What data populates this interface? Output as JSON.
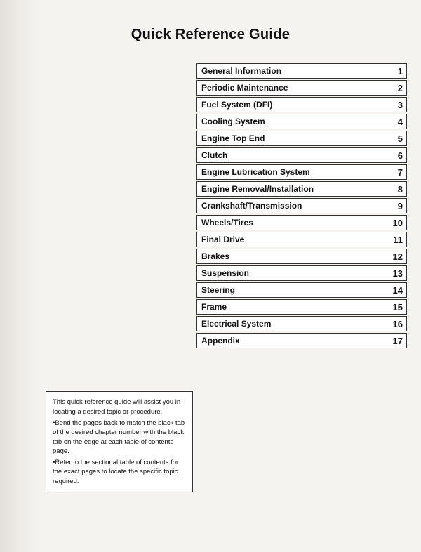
{
  "page": {
    "title": "Quick Reference Guide",
    "toc": [
      {
        "label": "General Information",
        "number": "1"
      },
      {
        "label": "Periodic Maintenance",
        "number": "2"
      },
      {
        "label": "Fuel System (DFI)",
        "number": "3"
      },
      {
        "label": "Cooling System",
        "number": "4"
      },
      {
        "label": "Engine Top End",
        "number": "5"
      },
      {
        "label": "Clutch",
        "number": "6"
      },
      {
        "label": "Engine Lubrication System",
        "number": "7"
      },
      {
        "label": "Engine Removal/Installation",
        "number": "8"
      },
      {
        "label": "Crankshaft/Transmission",
        "number": "9"
      },
      {
        "label": "Wheels/Tires",
        "number": "10"
      },
      {
        "label": "Final Drive",
        "number": "11"
      },
      {
        "label": "Brakes",
        "number": "12"
      },
      {
        "label": "Suspension",
        "number": "13"
      },
      {
        "label": "Steering",
        "number": "14"
      },
      {
        "label": "Frame",
        "number": "15"
      },
      {
        "label": "Electrical System",
        "number": "16"
      },
      {
        "label": "Appendix",
        "number": "17"
      }
    ],
    "note": {
      "lines": [
        "This quick reference guide will assist you in locating a desired topic or procedure.",
        "•Bend the pages back to match the black tab of the desired chapter number with the black tab on the edge at each table of contents page.",
        "•Refer to the sectional table of contents for the exact pages to locate the specific topic required."
      ]
    }
  }
}
